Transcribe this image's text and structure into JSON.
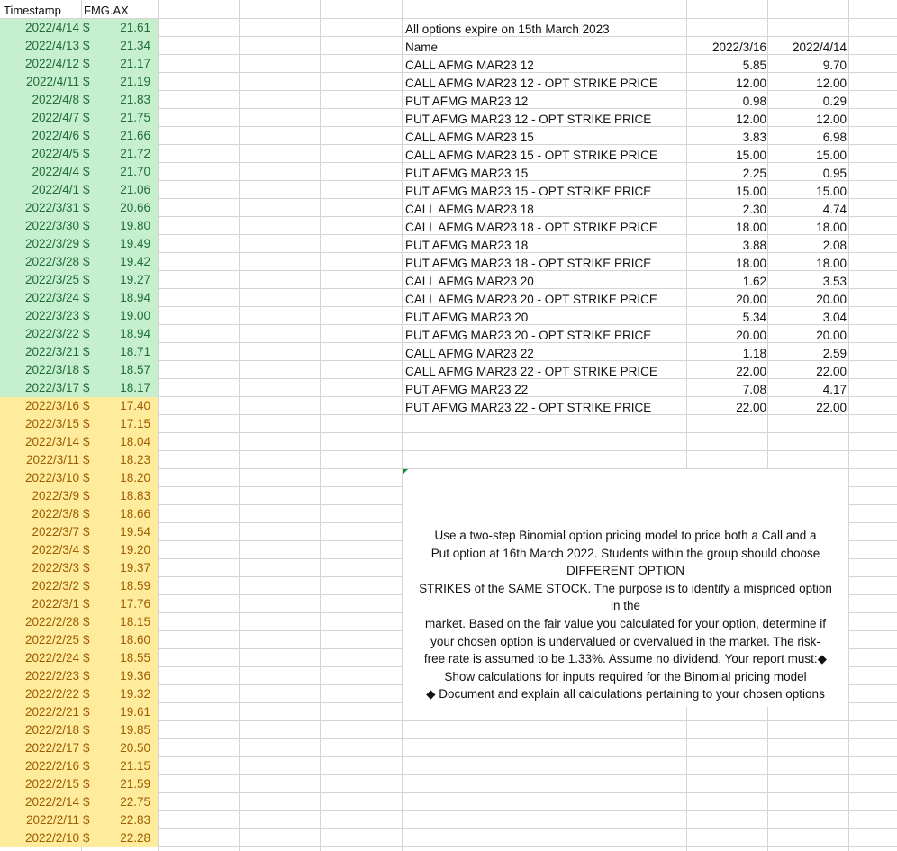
{
  "stock": {
    "header_timestamp": "Timestamp",
    "header_ticker": "FMG.AX",
    "currency": "$",
    "rows": [
      {
        "date": "2022/4/14",
        "price": "21.61"
      },
      {
        "date": "2022/4/13",
        "price": "21.34"
      },
      {
        "date": "2022/4/12",
        "price": "21.17"
      },
      {
        "date": "2022/4/11",
        "price": "21.19"
      },
      {
        "date": "2022/4/8",
        "price": "21.83"
      },
      {
        "date": "2022/4/7",
        "price": "21.75"
      },
      {
        "date": "2022/4/6",
        "price": "21.66"
      },
      {
        "date": "2022/4/5",
        "price": "21.72"
      },
      {
        "date": "2022/4/4",
        "price": "21.70"
      },
      {
        "date": "2022/4/1",
        "price": "21.06"
      },
      {
        "date": "2022/3/31",
        "price": "20.66"
      },
      {
        "date": "2022/3/30",
        "price": "19.80"
      },
      {
        "date": "2022/3/29",
        "price": "19.49"
      },
      {
        "date": "2022/3/28",
        "price": "19.42"
      },
      {
        "date": "2022/3/25",
        "price": "19.27"
      },
      {
        "date": "2022/3/24",
        "price": "18.94"
      },
      {
        "date": "2022/3/23",
        "price": "19.00"
      },
      {
        "date": "2022/3/22",
        "price": "18.94"
      },
      {
        "date": "2022/3/21",
        "price": "18.71"
      },
      {
        "date": "2022/3/18",
        "price": "18.57"
      },
      {
        "date": "2022/3/17",
        "price": "18.17"
      },
      {
        "date": "2022/3/16",
        "price": "17.40"
      },
      {
        "date": "2022/3/15",
        "price": "17.15"
      },
      {
        "date": "2022/3/14",
        "price": "18.04"
      },
      {
        "date": "2022/3/11",
        "price": "18.23"
      },
      {
        "date": "2022/3/10",
        "price": "18.20"
      },
      {
        "date": "2022/3/9",
        "price": "18.83"
      },
      {
        "date": "2022/3/8",
        "price": "18.66"
      },
      {
        "date": "2022/3/7",
        "price": "19.54"
      },
      {
        "date": "2022/3/4",
        "price": "19.20"
      },
      {
        "date": "2022/3/3",
        "price": "19.37"
      },
      {
        "date": "2022/3/2",
        "price": "18.59"
      },
      {
        "date": "2022/3/1",
        "price": "17.76"
      },
      {
        "date": "2022/2/28",
        "price": "18.15"
      },
      {
        "date": "2022/2/25",
        "price": "18.60"
      },
      {
        "date": "2022/2/24",
        "price": "18.55"
      },
      {
        "date": "2022/2/23",
        "price": "19.36"
      },
      {
        "date": "2022/2/22",
        "price": "19.32"
      },
      {
        "date": "2022/2/21",
        "price": "19.61"
      },
      {
        "date": "2022/2/18",
        "price": "19.85"
      },
      {
        "date": "2022/2/17",
        "price": "20.50"
      },
      {
        "date": "2022/2/16",
        "price": "21.15"
      },
      {
        "date": "2022/2/15",
        "price": "21.59"
      },
      {
        "date": "2022/2/14",
        "price": "22.75"
      },
      {
        "date": "2022/2/11",
        "price": "22.83"
      },
      {
        "date": "2022/2/10",
        "price": "22.28"
      }
    ],
    "green_count": 21,
    "green_color": "#c6efce",
    "yellow_color": "#ffeb9c"
  },
  "options": {
    "note": "All options expire on 15th March 2023",
    "header_name": "Name",
    "header_date1": "2022/3/16",
    "header_date2": "2022/4/14",
    "rows": [
      {
        "name": "CALL AFMG MAR23 12",
        "v1": "5.85",
        "v2": "9.70"
      },
      {
        "name": "CALL AFMG MAR23 12 - OPT STRIKE PRICE",
        "v1": "12.00",
        "v2": "12.00"
      },
      {
        "name": "PUT AFMG MAR23 12",
        "v1": "0.98",
        "v2": "0.29"
      },
      {
        "name": "PUT AFMG MAR23 12 - OPT STRIKE PRICE",
        "v1": "12.00",
        "v2": "12.00"
      },
      {
        "name": "CALL AFMG MAR23 15",
        "v1": "3.83",
        "v2": "6.98"
      },
      {
        "name": "CALL AFMG MAR23 15 - OPT STRIKE PRICE",
        "v1": "15.00",
        "v2": "15.00"
      },
      {
        "name": "PUT AFMG MAR23 15",
        "v1": "2.25",
        "v2": "0.95"
      },
      {
        "name": "PUT AFMG MAR23 15 - OPT STRIKE PRICE",
        "v1": "15.00",
        "v2": "15.00"
      },
      {
        "name": "CALL AFMG MAR23 18",
        "v1": "2.30",
        "v2": "4.74"
      },
      {
        "name": "CALL AFMG MAR23 18 - OPT STRIKE PRICE",
        "v1": "18.00",
        "v2": "18.00"
      },
      {
        "name": "PUT AFMG MAR23 18",
        "v1": "3.88",
        "v2": "2.08"
      },
      {
        "name": "PUT AFMG MAR23 18 - OPT STRIKE PRICE",
        "v1": "18.00",
        "v2": "18.00"
      },
      {
        "name": "CALL AFMG MAR23 20",
        "v1": "1.62",
        "v2": "3.53"
      },
      {
        "name": "CALL AFMG MAR23 20 - OPT STRIKE PRICE",
        "v1": "20.00",
        "v2": "20.00"
      },
      {
        "name": "PUT AFMG MAR23 20",
        "v1": "5.34",
        "v2": "3.04"
      },
      {
        "name": "PUT AFMG MAR23 20 - OPT STRIKE PRICE",
        "v1": "20.00",
        "v2": "20.00"
      },
      {
        "name": "CALL AFMG MAR23 22",
        "v1": "1.18",
        "v2": "2.59"
      },
      {
        "name": "CALL AFMG MAR23 22 - OPT STRIKE PRICE",
        "v1": "22.00",
        "v2": "22.00"
      },
      {
        "name": "PUT AFMG MAR23 22",
        "v1": "7.08",
        "v2": "4.17"
      },
      {
        "name": "PUT AFMG MAR23 22 - OPT STRIKE PRICE",
        "v1": "22.00",
        "v2": "22.00"
      }
    ]
  },
  "instructions": {
    "lines": [
      "Use a two-step Binomial option pricing model to price both a Call and a",
      "Put option at 16th March 2022. Students within the group should choose",
      "DIFFERENT OPTION",
      "STRIKES of the SAME STOCK. The purpose is to identify a mispriced option",
      "in the",
      "market. Based on the fair value you calculated for your option, determine if",
      "your chosen option is undervalued or overvalued in the market. The risk-",
      "free rate is assumed to be 1.33%. Assume no dividend. Your report must:◆",
      "Show calculations for inputs required for the Binomial pricing model",
      "◆ Document and explain all calculations pertaining to your chosen options"
    ]
  }
}
